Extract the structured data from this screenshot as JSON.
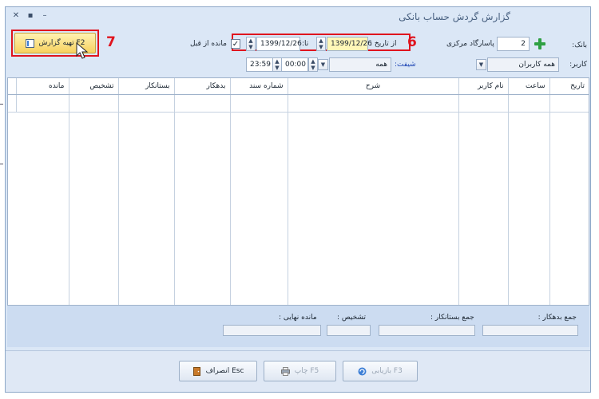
{
  "window": {
    "title": "گزارش گردش حساب بانکی"
  },
  "toolbar": {
    "prepare_label": "تهیه گزارش F2"
  },
  "annotations": {
    "step_7": "7",
    "step_6": "6"
  },
  "filters": {
    "bank_label": "بانک:",
    "bank_code": "2",
    "bank_name": "پاسارگاد مرکزی",
    "user_label": "کاربر:",
    "user_value": "همه کاربران",
    "from_date_label": "از تاریخ :",
    "from_date": "1399/12/26",
    "to_date_label": "تا:",
    "to_date": "1399/12/26",
    "prev_balance_label": "مانده از قبل",
    "prev_balance_checked": true,
    "shift_label": "شیفت:",
    "shift_value": "همه",
    "time_from": "00:00",
    "time_to": "23:59"
  },
  "table": {
    "columns": [
      "تاریخ",
      "ساعت",
      "نام کاربر",
      "شرح",
      "شماره سند",
      "بدهکار",
      "بستانکار",
      "تشخیص",
      "مانده"
    ],
    "rows": []
  },
  "summary": {
    "total_debit_label": "جمع بدهکار :",
    "total_credit_label": "جمع بستانکار :",
    "diagnosis_label": "تشخیص :",
    "final_balance_label": "مانده نهایی :"
  },
  "buttons": {
    "refresh_label": "بازیابی F3",
    "print_label": "چاپ F5",
    "cancel_label": "انصراف Esc"
  }
}
